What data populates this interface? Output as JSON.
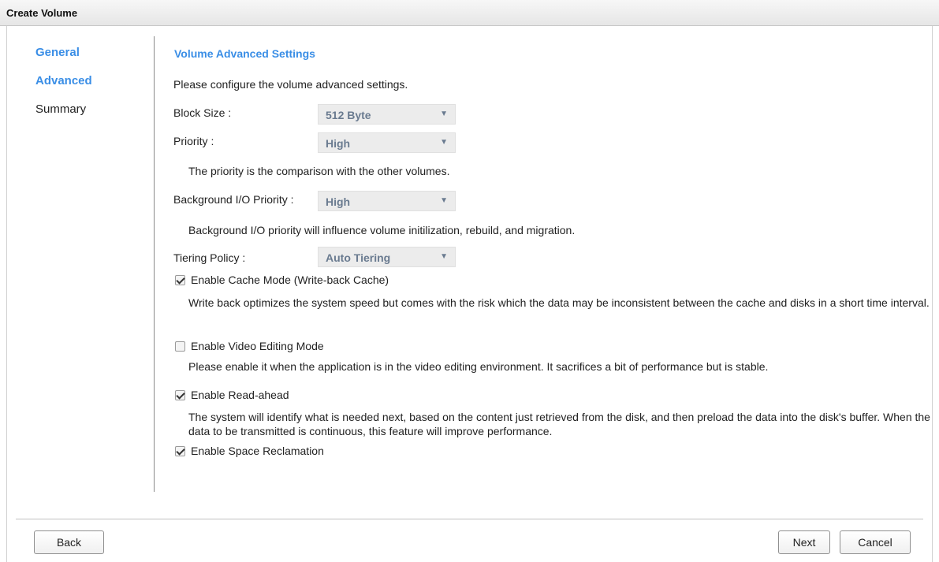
{
  "window": {
    "title": "Create Volume"
  },
  "nav": {
    "items": [
      {
        "label": "General",
        "state": "active"
      },
      {
        "label": "Advanced",
        "state": "active"
      },
      {
        "label": "Summary",
        "state": "inactive"
      }
    ]
  },
  "main": {
    "section_title": "Volume Advanced Settings",
    "intro": "Please configure the volume advanced settings.",
    "block_size": {
      "label": "Block Size :",
      "value": "512 Byte"
    },
    "priority": {
      "label": "Priority :",
      "value": "High",
      "note": "The priority is the comparison with the other volumes."
    },
    "bg_io_priority": {
      "label": "Background I/O Priority :",
      "value": "High",
      "note": "Background I/O priority will influence volume initilization, rebuild, and migration."
    },
    "tiering_policy": {
      "label": "Tiering Policy :",
      "value": "Auto Tiering"
    },
    "cache_mode": {
      "label": "Enable Cache Mode (Write-back Cache)",
      "checked": true,
      "desc": "Write back optimizes the system speed but comes with the risk which the data may be inconsistent between the cache and disks in a short time interval."
    },
    "video_editing": {
      "label": "Enable Video Editing Mode",
      "checked": false,
      "desc": "Please enable it when the application is in the video editing environment. It sacrifices a bit of performance but is stable."
    },
    "read_ahead": {
      "label": "Enable Read-ahead",
      "checked": true,
      "desc": "The system will identify what is needed next, based on the content just retrieved from the disk, and then preload the data into the disk's buffer. When the data to be transmitted is continuous, this feature will improve performance."
    },
    "space_reclamation": {
      "label": "Enable Space Reclamation",
      "checked": true
    }
  },
  "footer": {
    "back_label": "Back",
    "next_label": "Next",
    "cancel_label": "Cancel"
  },
  "icons": {
    "dropdown": "chevron-down-icon",
    "check": "check-icon"
  },
  "colors": {
    "accent": "#3a8ee6",
    "select_text": "#6a7b90",
    "select_bg": "#ececec"
  }
}
